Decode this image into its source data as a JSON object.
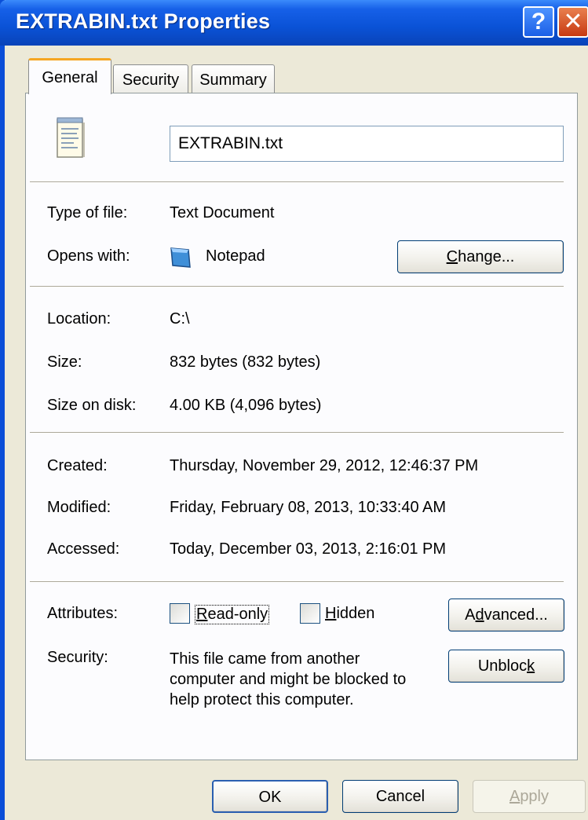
{
  "window": {
    "title": "EXTRABIN.txt Properties",
    "help_glyph": "?",
    "close_glyph": "✕"
  },
  "tabs": [
    {
      "label": "General",
      "active": true
    },
    {
      "label": "Security",
      "active": false
    },
    {
      "label": "Summary",
      "active": false
    }
  ],
  "general": {
    "file_name": "EXTRABIN.txt",
    "type_label": "Type of file:",
    "type_value": "Text Document",
    "opens_label": "Opens with:",
    "opens_value": "Notepad",
    "change_label_pre": "",
    "change_label_u": "C",
    "change_label_post": "hange...",
    "location_label": "Location:",
    "location_value": "C:\\",
    "size_label": "Size:",
    "size_value": "832 bytes (832 bytes)",
    "size_disk_label": "Size on disk:",
    "size_disk_value": "4.00 KB (4,096 bytes)",
    "created_label": "Created:",
    "created_value": "Thursday, November 29, 2012, 12:46:37 PM",
    "modified_label": "Modified:",
    "modified_value": "Friday, February 08, 2013, 10:33:40 AM",
    "accessed_label": "Accessed:",
    "accessed_value": "Today, December 03, 2013, 2:16:01 PM",
    "attributes_label": "Attributes:",
    "readonly_u": "R",
    "readonly_rest": "ead-only",
    "readonly_checked": false,
    "hidden_u": "H",
    "hidden_rest": "idden",
    "hidden_checked": false,
    "advanced_pre": "A",
    "advanced_u": "d",
    "advanced_post": "vanced...",
    "security_label": "Security:",
    "security_line1": "This file came from another",
    "security_line2": "computer and might be blocked to",
    "security_line3": "help protect this computer.",
    "unblock_pre": "Unbloc",
    "unblock_u": "k",
    "unblock_post": ""
  },
  "footer": {
    "ok_label": "OK",
    "cancel_label": "Cancel",
    "apply_u": "A",
    "apply_rest": "pply",
    "apply_enabled": false
  },
  "icons": {
    "file_icon": "notepad-file-icon",
    "app_icon": "notepad-app-icon"
  },
  "colors": {
    "titlebar": "#0a52d6",
    "dialog_bg": "#ece9d8",
    "tab_highlight": "#f5a623",
    "close_button": "#c73a12"
  }
}
